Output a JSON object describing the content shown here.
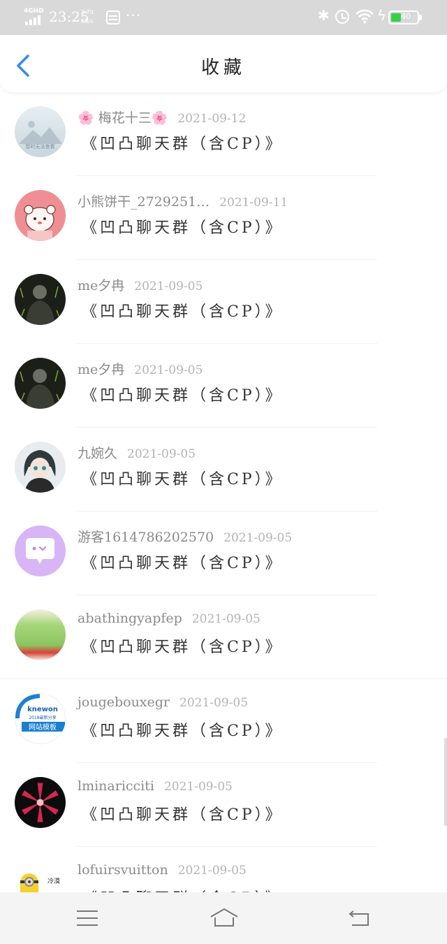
{
  "status_bar": {
    "network": "4GHD",
    "time": "23:25",
    "speed_top": "3.70",
    "speed_bottom": "KB/s",
    "more": "···",
    "battery_level": "40",
    "battery_fraction": 0.4
  },
  "header": {
    "title": "收藏",
    "back_icon": "chevron-left-icon",
    "accent": "#2f8cf5"
  },
  "favorites": [
    {
      "name": "🌸 梅花十三🌸",
      "date": "2021-09-12",
      "group": "《凹凸聊天群（含CP）》",
      "avatar": "landscape",
      "avatar_text": "暂时无法查看"
    },
    {
      "name": "小熊饼干_2729251…",
      "date": "2021-09-11",
      "group": "《凹凸聊天群（含CP）》",
      "avatar": "pink-bear"
    },
    {
      "name": "me夕冉",
      "date": "2021-09-05",
      "group": "《凹凸聊天群（含CP）》",
      "avatar": "dark-figure"
    },
    {
      "name": "me夕冉",
      "date": "2021-09-05",
      "group": "《凹凸聊天群（含CP）》",
      "avatar": "dark-figure"
    },
    {
      "name": "九婉久",
      "date": "2021-09-05",
      "group": "《凹凸聊天群（含CP）》",
      "avatar": "anime-girl"
    },
    {
      "name": "游客1614786202570",
      "date": "2021-09-05",
      "group": "《凹凸聊天群（含CP）》",
      "avatar": "chat-bubble"
    },
    {
      "name": "abathingyapfep",
      "date": "2021-09-05",
      "group": "《凹凸聊天群（含CP）》",
      "avatar": "jelly"
    },
    {
      "name": "jougebouxegr",
      "date": "2021-09-05",
      "group": "《凹凸聊天群（含CP）》",
      "avatar": "knewon",
      "avatar_text_1": "knewon",
      "avatar_text_2": "2018最新分享",
      "avatar_text_3": "网站模板"
    },
    {
      "name": "lminaricciti",
      "date": "2021-09-05",
      "group": "《凹凸聊天群（含CP）》",
      "avatar": "lily"
    },
    {
      "name": "lofuirsvuitton",
      "date": "2021-09-05",
      "group": "《凹凸聊天群（含CP）》",
      "avatar": "minion",
      "avatar_text": "冷漠"
    }
  ],
  "bottom_nav": {
    "menu_icon": "menu-icon",
    "home_icon": "home-icon",
    "back_icon": "return-icon"
  }
}
